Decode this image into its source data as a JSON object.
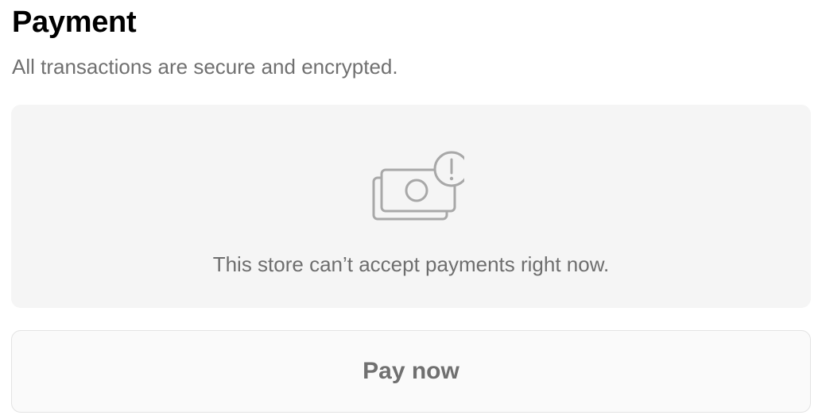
{
  "header": {
    "title": "Payment",
    "subtitle": "All transactions are secure and encrypted."
  },
  "notice": {
    "icon": "cash-warning-icon",
    "message": "This store can’t accept payments right now."
  },
  "actions": {
    "pay_label": "Pay now",
    "pay_disabled": true
  },
  "colors": {
    "panel_background": "#f5f5f5",
    "muted_text": "#707070",
    "icon_stroke": "#a8a8a8",
    "button_border": "#e3e3e3"
  }
}
